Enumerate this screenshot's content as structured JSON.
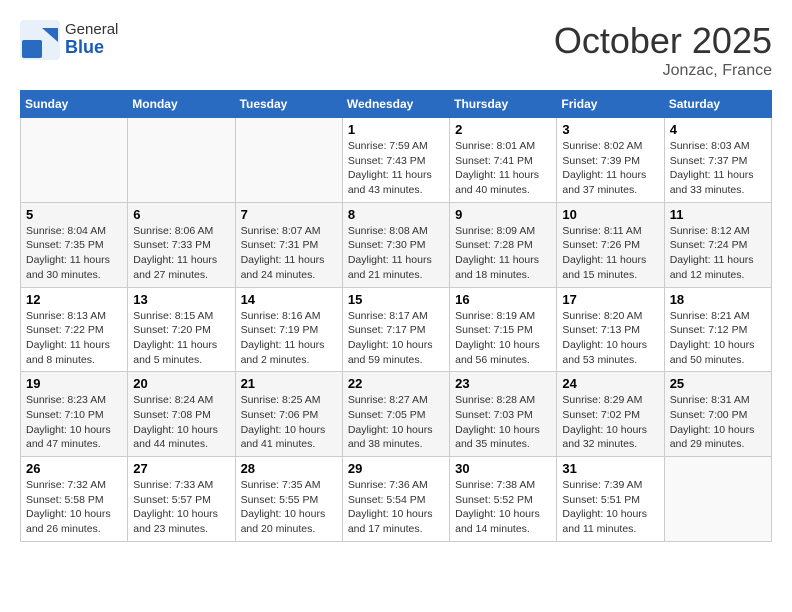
{
  "header": {
    "logo_general": "General",
    "logo_blue": "Blue",
    "month_title": "October 2025",
    "location": "Jonzac, France"
  },
  "days_of_week": [
    "Sunday",
    "Monday",
    "Tuesday",
    "Wednesday",
    "Thursday",
    "Friday",
    "Saturday"
  ],
  "weeks": [
    [
      {
        "day": "",
        "info": ""
      },
      {
        "day": "",
        "info": ""
      },
      {
        "day": "",
        "info": ""
      },
      {
        "day": "1",
        "info": "Sunrise: 7:59 AM\nSunset: 7:43 PM\nDaylight: 11 hours and 43 minutes."
      },
      {
        "day": "2",
        "info": "Sunrise: 8:01 AM\nSunset: 7:41 PM\nDaylight: 11 hours and 40 minutes."
      },
      {
        "day": "3",
        "info": "Sunrise: 8:02 AM\nSunset: 7:39 PM\nDaylight: 11 hours and 37 minutes."
      },
      {
        "day": "4",
        "info": "Sunrise: 8:03 AM\nSunset: 7:37 PM\nDaylight: 11 hours and 33 minutes."
      }
    ],
    [
      {
        "day": "5",
        "info": "Sunrise: 8:04 AM\nSunset: 7:35 PM\nDaylight: 11 hours and 30 minutes."
      },
      {
        "day": "6",
        "info": "Sunrise: 8:06 AM\nSunset: 7:33 PM\nDaylight: 11 hours and 27 minutes."
      },
      {
        "day": "7",
        "info": "Sunrise: 8:07 AM\nSunset: 7:31 PM\nDaylight: 11 hours and 24 minutes."
      },
      {
        "day": "8",
        "info": "Sunrise: 8:08 AM\nSunset: 7:30 PM\nDaylight: 11 hours and 21 minutes."
      },
      {
        "day": "9",
        "info": "Sunrise: 8:09 AM\nSunset: 7:28 PM\nDaylight: 11 hours and 18 minutes."
      },
      {
        "day": "10",
        "info": "Sunrise: 8:11 AM\nSunset: 7:26 PM\nDaylight: 11 hours and 15 minutes."
      },
      {
        "day": "11",
        "info": "Sunrise: 8:12 AM\nSunset: 7:24 PM\nDaylight: 11 hours and 12 minutes."
      }
    ],
    [
      {
        "day": "12",
        "info": "Sunrise: 8:13 AM\nSunset: 7:22 PM\nDaylight: 11 hours and 8 minutes."
      },
      {
        "day": "13",
        "info": "Sunrise: 8:15 AM\nSunset: 7:20 PM\nDaylight: 11 hours and 5 minutes."
      },
      {
        "day": "14",
        "info": "Sunrise: 8:16 AM\nSunset: 7:19 PM\nDaylight: 11 hours and 2 minutes."
      },
      {
        "day": "15",
        "info": "Sunrise: 8:17 AM\nSunset: 7:17 PM\nDaylight: 10 hours and 59 minutes."
      },
      {
        "day": "16",
        "info": "Sunrise: 8:19 AM\nSunset: 7:15 PM\nDaylight: 10 hours and 56 minutes."
      },
      {
        "day": "17",
        "info": "Sunrise: 8:20 AM\nSunset: 7:13 PM\nDaylight: 10 hours and 53 minutes."
      },
      {
        "day": "18",
        "info": "Sunrise: 8:21 AM\nSunset: 7:12 PM\nDaylight: 10 hours and 50 minutes."
      }
    ],
    [
      {
        "day": "19",
        "info": "Sunrise: 8:23 AM\nSunset: 7:10 PM\nDaylight: 10 hours and 47 minutes."
      },
      {
        "day": "20",
        "info": "Sunrise: 8:24 AM\nSunset: 7:08 PM\nDaylight: 10 hours and 44 minutes."
      },
      {
        "day": "21",
        "info": "Sunrise: 8:25 AM\nSunset: 7:06 PM\nDaylight: 10 hours and 41 minutes."
      },
      {
        "day": "22",
        "info": "Sunrise: 8:27 AM\nSunset: 7:05 PM\nDaylight: 10 hours and 38 minutes."
      },
      {
        "day": "23",
        "info": "Sunrise: 8:28 AM\nSunset: 7:03 PM\nDaylight: 10 hours and 35 minutes."
      },
      {
        "day": "24",
        "info": "Sunrise: 8:29 AM\nSunset: 7:02 PM\nDaylight: 10 hours and 32 minutes."
      },
      {
        "day": "25",
        "info": "Sunrise: 8:31 AM\nSunset: 7:00 PM\nDaylight: 10 hours and 29 minutes."
      }
    ],
    [
      {
        "day": "26",
        "info": "Sunrise: 7:32 AM\nSunset: 5:58 PM\nDaylight: 10 hours and 26 minutes."
      },
      {
        "day": "27",
        "info": "Sunrise: 7:33 AM\nSunset: 5:57 PM\nDaylight: 10 hours and 23 minutes."
      },
      {
        "day": "28",
        "info": "Sunrise: 7:35 AM\nSunset: 5:55 PM\nDaylight: 10 hours and 20 minutes."
      },
      {
        "day": "29",
        "info": "Sunrise: 7:36 AM\nSunset: 5:54 PM\nDaylight: 10 hours and 17 minutes."
      },
      {
        "day": "30",
        "info": "Sunrise: 7:38 AM\nSunset: 5:52 PM\nDaylight: 10 hours and 14 minutes."
      },
      {
        "day": "31",
        "info": "Sunrise: 7:39 AM\nSunset: 5:51 PM\nDaylight: 10 hours and 11 minutes."
      },
      {
        "day": "",
        "info": ""
      }
    ]
  ]
}
